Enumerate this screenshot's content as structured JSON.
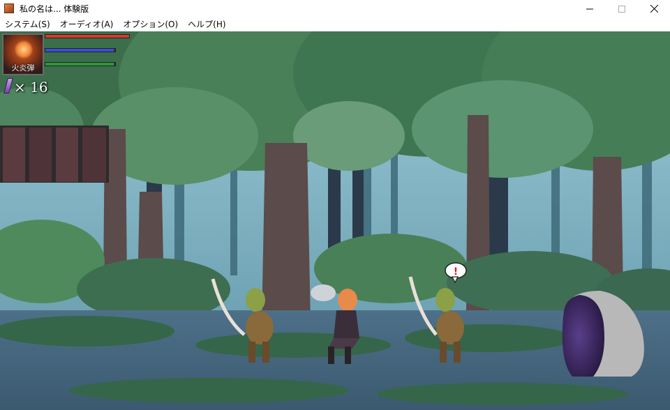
{
  "window": {
    "title": "私の名は... 体験版",
    "controls": [
      "minimize-icon",
      "maximize-icon",
      "close-icon"
    ]
  },
  "menu": {
    "items": [
      {
        "label": "システム(S)"
      },
      {
        "label": "オーディオ(A)"
      },
      {
        "label": "オプション(O)"
      },
      {
        "label": "ヘルプ(H)"
      }
    ]
  },
  "hud": {
    "portrait_label": "火炎弾",
    "bars": [
      {
        "name": "health",
        "color": "#d83a2a",
        "fill": 1.0
      },
      {
        "name": "mana",
        "color": "#3a4fd8",
        "fill": 0.98
      },
      {
        "name": "stamina",
        "color": "#2a9a3a",
        "fill": 0.98
      }
    ],
    "item_count": "× 16"
  },
  "scene": {
    "enemy_alert": "!",
    "colors": {
      "sky": "#7fb6c8",
      "foliage": "#3f7a5a",
      "trunk": "#5a4a48",
      "ground": "#4a6a80"
    }
  }
}
